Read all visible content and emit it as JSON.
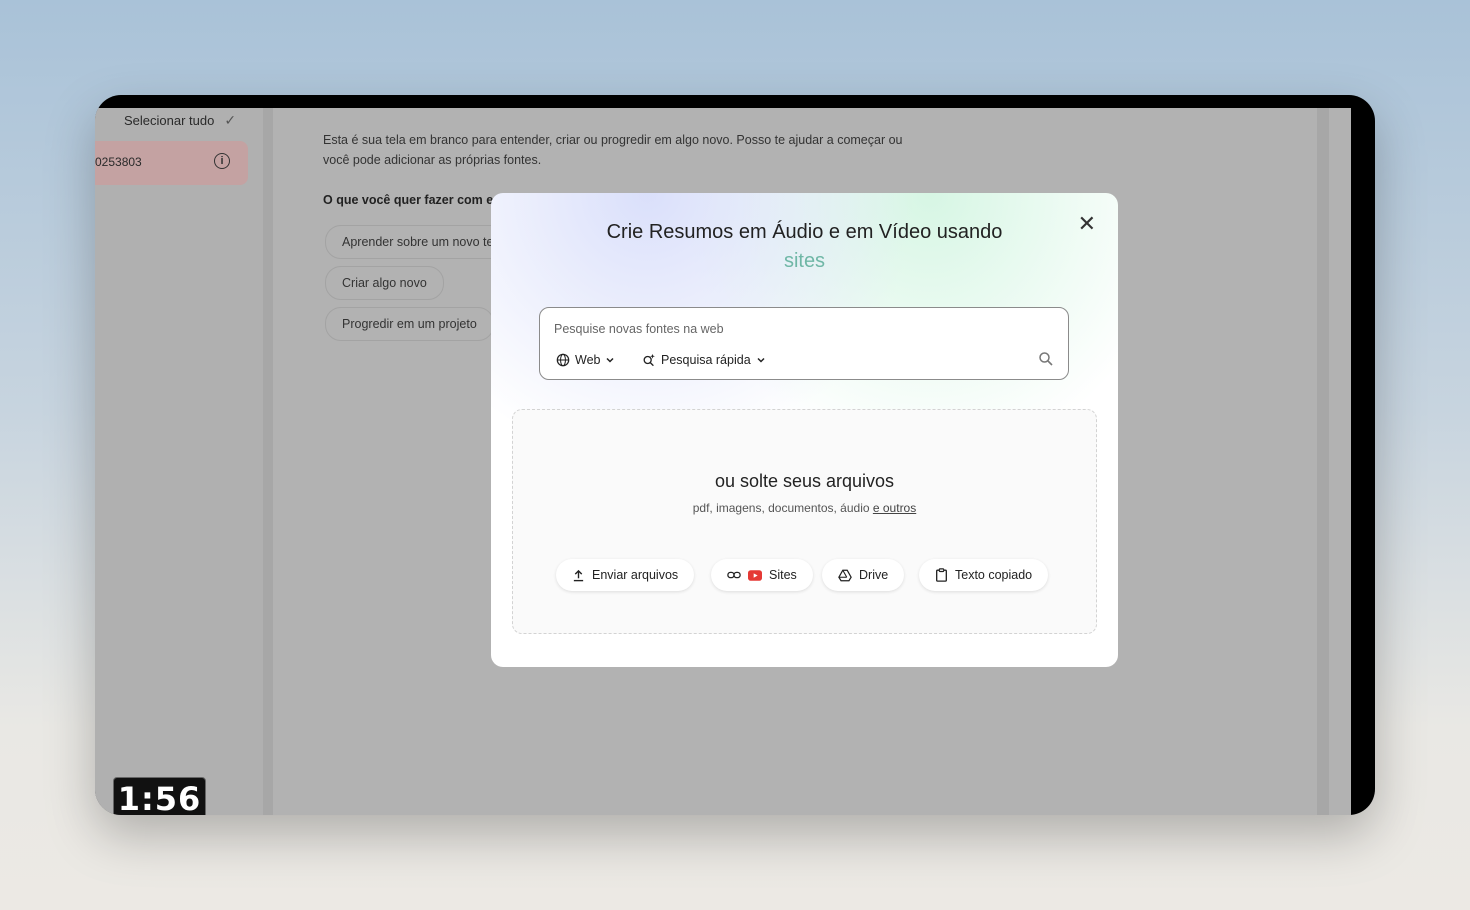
{
  "sidebar": {
    "select_all": "Selecionar tudo",
    "source_id": "0253803"
  },
  "main": {
    "intro_line1": "Esta é sua tela em branco para entender, criar ou progredir em algo novo. Posso te ajudar a começar ou",
    "intro_line2": "você pode adicionar as próprias fontes.",
    "question": "O que você quer fazer com es",
    "options": [
      "Aprender sobre um novo te",
      "Criar algo novo",
      "Progredir em um projeto"
    ]
  },
  "modal": {
    "title": "Crie Resumos em Áudio e em Vídeo usando",
    "subtitle": "sites",
    "search_placeholder": "Pesquise novas fontes na web",
    "web_chip": "Web",
    "mode_chip": "Pesquisa rápida",
    "drop_title": "ou solte seus arquivos",
    "drop_hint": "pdf, imagens, documentos, áudio",
    "drop_hint_link": "e outros",
    "buttons": {
      "upload": "Enviar arquivos",
      "sites": "Sites",
      "drive": "Drive",
      "text": "Texto copiado"
    }
  },
  "timer": "1:56",
  "colors": {
    "subtitle_accent": "#6fb7a6",
    "youtube_red": "#e53935",
    "selected_source": "#c4a2a2"
  }
}
